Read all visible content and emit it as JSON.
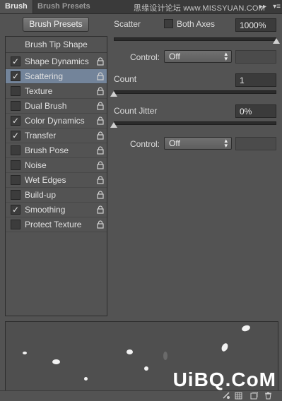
{
  "tabs": [
    {
      "label": "Brush"
    },
    {
      "label": "Brush Presets"
    }
  ],
  "watermark": "思缘设计论坛 www.MISSYUAN.COM",
  "panel_controls": {
    "collapse": "▸▸",
    "menu": "▾≡"
  },
  "brush_presets_button": "Brush Presets",
  "list": {
    "header": "Brush Tip Shape",
    "items": [
      {
        "label": "Shape Dynamics",
        "checked": true,
        "selected": false
      },
      {
        "label": "Scattering",
        "checked": true,
        "selected": true
      },
      {
        "label": "Texture",
        "checked": false,
        "selected": false
      },
      {
        "label": "Dual Brush",
        "checked": false,
        "selected": false
      },
      {
        "label": "Color Dynamics",
        "checked": true,
        "selected": false
      },
      {
        "label": "Transfer",
        "checked": true,
        "selected": false
      },
      {
        "label": "Brush Pose",
        "checked": false,
        "selected": false
      },
      {
        "label": "Noise",
        "checked": false,
        "selected": false
      },
      {
        "label": "Wet Edges",
        "checked": false,
        "selected": false
      },
      {
        "label": "Build-up",
        "checked": false,
        "selected": false
      },
      {
        "label": "Smoothing",
        "checked": true,
        "selected": false
      },
      {
        "label": "Protect Texture",
        "checked": false,
        "selected": false
      }
    ]
  },
  "scatter": {
    "label": "Scatter",
    "both_axes_label": "Both Axes",
    "both_axes_checked": false,
    "value": "1000%",
    "slider_fraction": 1.0
  },
  "control1": {
    "label": "Control:",
    "value": "Off"
  },
  "count": {
    "label": "Count",
    "value": "1",
    "slider_fraction": 0.0
  },
  "count_jitter": {
    "label": "Count Jitter",
    "value": "0%",
    "slider_fraction": 0.0
  },
  "control2": {
    "label": "Control:",
    "value": "Off"
  },
  "brand": "UiBQ.CoM",
  "colors": {
    "selected_row": "#73849a",
    "panel_bg": "#535353"
  }
}
